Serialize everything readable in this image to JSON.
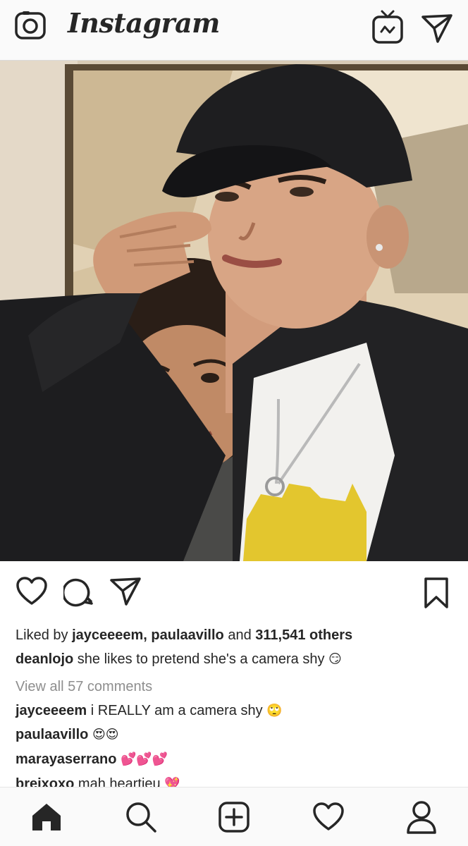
{
  "header": {
    "brand": "Instagram",
    "camera_icon": "camera-icon",
    "igtv_icon": "igtv-icon",
    "direct_icon": "direct-message-icon"
  },
  "post": {
    "image_alt": "selfie-photo"
  },
  "actions": {
    "like_icon": "heart-icon",
    "comment_icon": "comment-icon",
    "share_icon": "share-icon",
    "save_icon": "bookmark-icon"
  },
  "likes": {
    "prefix": "Liked by",
    "user1": "jayceeeem,",
    "user2": "paulaavillo",
    "and": "and",
    "others": "311,541 others"
  },
  "caption": {
    "user": "deanlojo",
    "text": "she likes to pretend she's a camera shy",
    "emoji": "😏"
  },
  "view_all": "View all 57 comments",
  "comments": [
    {
      "user": "jayceeeem",
      "text": "i REALLY am a camera shy",
      "emoji": "🙄"
    },
    {
      "user": "paulaavillo",
      "text": "",
      "emoji": "😍😍"
    },
    {
      "user": "marayaserrano",
      "text": "",
      "emoji": "💕💕💕"
    },
    {
      "user": "breixoxo",
      "text": "mah heartieu",
      "emoji": "💖"
    }
  ],
  "nav": {
    "home": "home-icon",
    "search": "search-icon",
    "new_post": "add-post-icon",
    "activity": "activity-heart-icon",
    "profile": "profile-icon"
  },
  "colors": {
    "text": "#262626",
    "muted": "#8e8e8e",
    "bar_bg": "#fafafa"
  }
}
